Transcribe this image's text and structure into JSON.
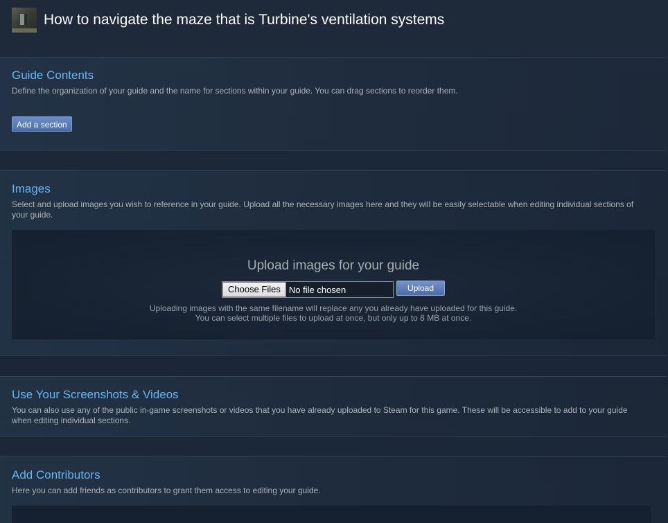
{
  "header": {
    "title": "How to navigate the maze that is Turbine's ventilation systems"
  },
  "contents": {
    "title": "Guide Contents",
    "description": "Define the organization of your guide and the name for sections within your guide. You can drag sections to reorder them.",
    "add_section_label": "Add a section"
  },
  "images": {
    "title": "Images",
    "description": "Select and upload images you wish to reference in your guide. Upload all the necessary images here and they will be easily selectable when editing individual sections of your guide.",
    "upload_title": "Upload images for your guide",
    "choose_files_label": "Choose Files",
    "no_file_text": "No file chosen",
    "upload_label": "Upload",
    "note_line1": "Uploading images with the same filename will replace any you already have uploaded for this guide.",
    "note_line2": "You can select multiple files to upload at once, but only up to 8 MB at once."
  },
  "screenshots": {
    "title": "Use Your Screenshots & Videos",
    "description": "You can also use any of the public in-game screenshots or videos that you have already uploaded to Steam for this game. These will be accessible to add to your guide when editing individual sections."
  },
  "contributors": {
    "title": "Add Contributors",
    "description": "Here you can add friends as contributors to grant them access to editing your guide."
  },
  "colors": {
    "background": "#1b2838",
    "accent_title": "#66b6f0",
    "button_blue": "#4a6ea8"
  }
}
